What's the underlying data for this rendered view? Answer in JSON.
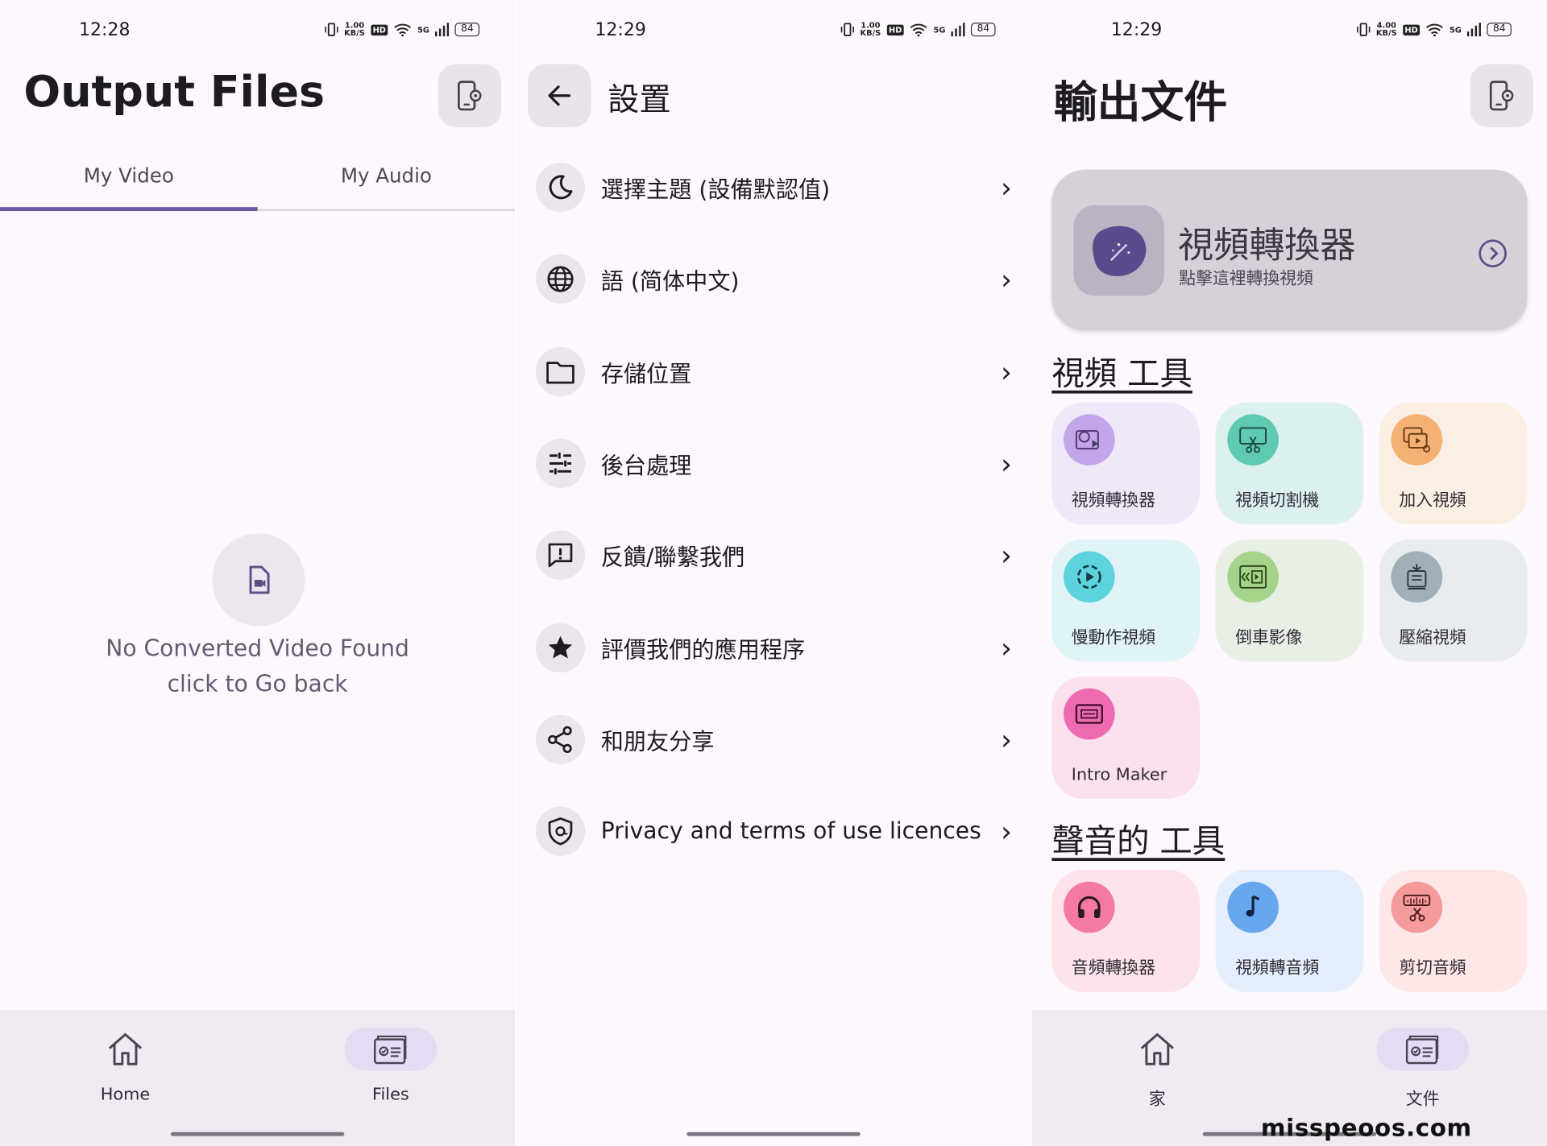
{
  "colors": {
    "accent": "#6b5aa3",
    "background": "#fdf8fd",
    "nav": "#f0ebf2"
  },
  "screen1": {
    "status": {
      "time": "12:28",
      "speed_top": "1.00",
      "speed_unit": "KB/S",
      "hd": "HD",
      "net": "5G",
      "battery": "84"
    },
    "title": "Output Files",
    "settings_icon": "phone-settings-icon",
    "tabs": [
      {
        "label": "My Video",
        "active": true
      },
      {
        "label": "My Audio",
        "active": false
      }
    ],
    "empty": {
      "icon": "video-file-icon",
      "line1": "No Converted Video Found",
      "line2": "click to Go back"
    },
    "nav": [
      {
        "label": "Home",
        "icon": "home-icon"
      },
      {
        "label": "Files",
        "icon": "files-icon",
        "active": true
      }
    ]
  },
  "screen2": {
    "status": {
      "time": "12:29",
      "speed_top": "1.00",
      "speed_unit": "KB/S",
      "hd": "HD",
      "net": "5G",
      "battery": "84"
    },
    "title": "設置",
    "back_icon": "arrow-left-icon",
    "items": [
      {
        "label": "選擇主題 (設備默認值)",
        "icon": "moon-icon"
      },
      {
        "label": "語 (简体中文)",
        "icon": "globe-icon"
      },
      {
        "label": "存儲位置",
        "icon": "folder-icon"
      },
      {
        "label": "後台處理",
        "icon": "sliders-icon"
      },
      {
        "label": "反饋/聯繫我們",
        "icon": "feedback-icon"
      },
      {
        "label": "評價我們的應用程序",
        "icon": "star-icon"
      },
      {
        "label": "和朋友分享",
        "icon": "share-icon"
      },
      {
        "label": "Privacy and terms of use licences",
        "icon": "shield-icon"
      }
    ]
  },
  "screen3": {
    "status": {
      "time": "12:29",
      "speed_top": "4.00",
      "speed_unit": "KB/S",
      "hd": "HD",
      "net": "5G",
      "battery": "84"
    },
    "title": "輸出文件",
    "banner": {
      "title": "視頻轉換器",
      "subtitle": "點擊這裡轉換視頻"
    },
    "video_section": "視頻 工具",
    "video_tools": [
      {
        "label": "視頻轉換器",
        "icon": "video-convert-icon",
        "bg": "#efe8f8",
        "iconbg": "#c3a6e9"
      },
      {
        "label": "視頻切割機",
        "icon": "video-cut-icon",
        "bg": "#dcf1ef",
        "iconbg": "#5fc9b2"
      },
      {
        "label": "加入視頻",
        "icon": "video-join-icon",
        "bg": "#fbeee2",
        "iconbg": "#f5b073"
      },
      {
        "label": "慢動作視頻",
        "icon": "slow-motion-icon",
        "bg": "#e0f3f6",
        "iconbg": "#5dd3de"
      },
      {
        "label": "倒車影像",
        "icon": "reverse-icon",
        "bg": "#e8f0e5",
        "iconbg": "#a6d38a"
      },
      {
        "label": "壓縮視頻",
        "icon": "compress-icon",
        "bg": "#e9ecef",
        "iconbg": "#9fb0b8"
      },
      {
        "label": "Intro Maker",
        "icon": "intro-maker-icon",
        "bg": "#fbe0ee",
        "iconbg": "#ee6bb1"
      }
    ],
    "audio_section": "聲音的 工具",
    "audio_tools": [
      {
        "label": "音頻轉換器",
        "icon": "headphones-icon",
        "bg": "#fde3ea",
        "iconbg": "#f47aa1"
      },
      {
        "label": "視頻轉音頻",
        "icon": "music-note-icon",
        "bg": "#e5eefc",
        "iconbg": "#66a7ee"
      },
      {
        "label": "剪切音頻",
        "icon": "audio-cut-icon",
        "bg": "#fde7e7",
        "iconbg": "#f59a9a"
      }
    ],
    "nav": [
      {
        "label": "家",
        "icon": "home-icon"
      },
      {
        "label": "文件",
        "icon": "files-icon",
        "active": true
      }
    ],
    "watermark": "misspeoos.com"
  }
}
